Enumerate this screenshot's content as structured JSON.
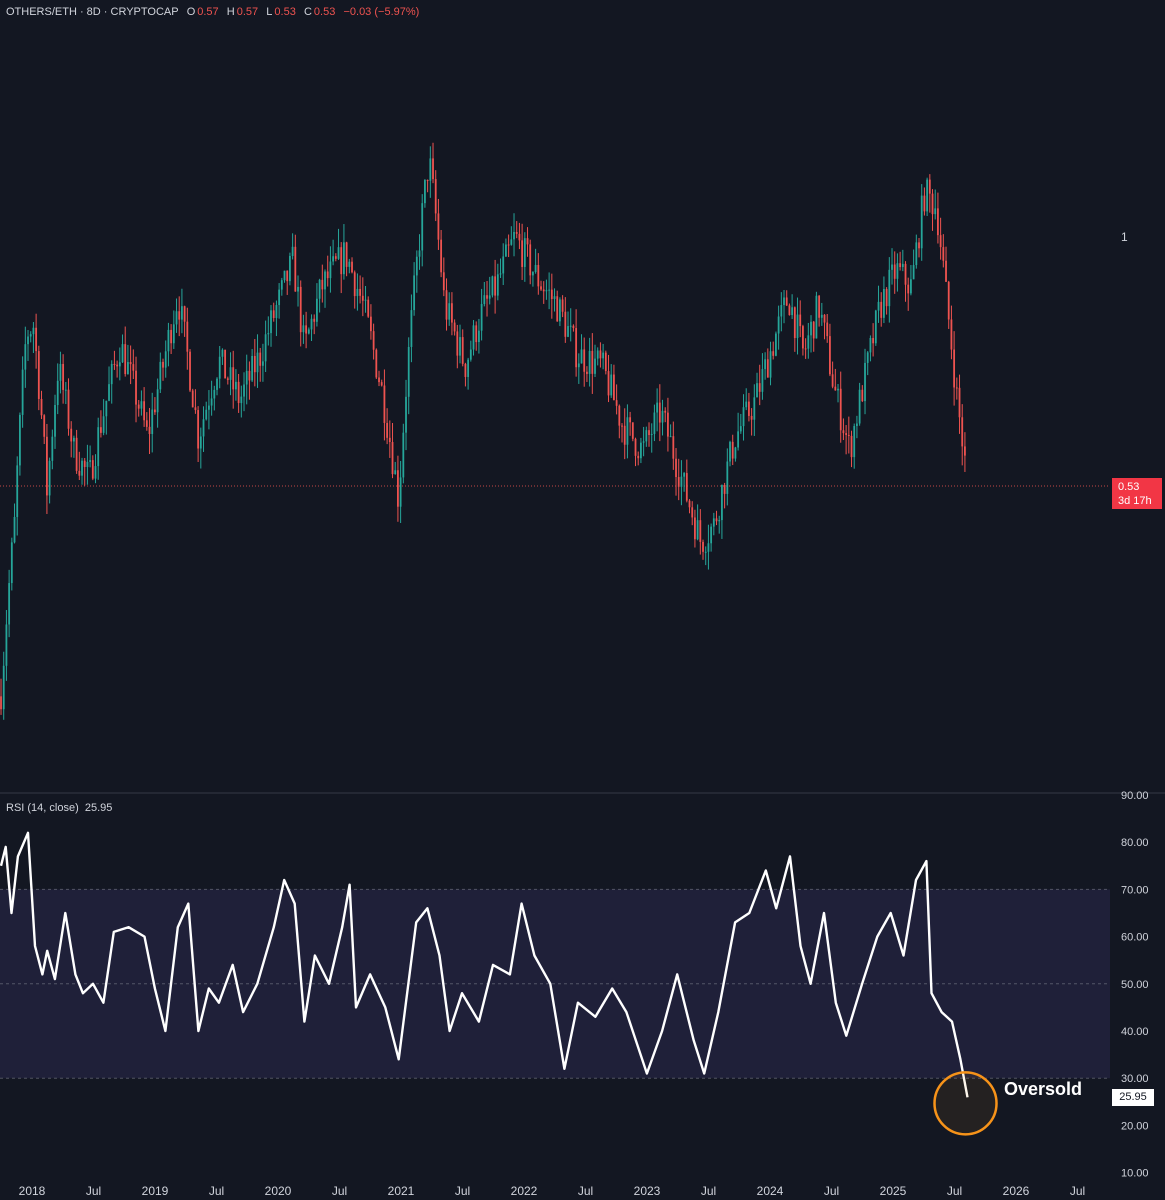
{
  "header": {
    "symbol": "OTHERS/ETH · 8D · CRYPTOCAP",
    "o_label": "O",
    "o_value": "0.57",
    "h_label": "H",
    "h_value": "0.57",
    "l_label": "L",
    "l_value": "0.53",
    "c_label": "C",
    "c_value": "0.53",
    "change": "−0.03 (−5.97%)"
  },
  "price_pane": {
    "axis_label": "1",
    "last_price": "0.53",
    "countdown": "3d 17h"
  },
  "rsi_pane": {
    "label": "RSI (14, close)",
    "value": "25.95",
    "axis_labels": [
      "90.00",
      "80.00",
      "70.00",
      "60.00",
      "50.00",
      "40.00",
      "30.00",
      "20.00",
      "10.00"
    ],
    "annotation": "Oversold"
  },
  "x_axis": [
    "2018",
    "Jul",
    "2019",
    "Jul",
    "2020",
    "Jul",
    "2021",
    "Jul",
    "2022",
    "Jul",
    "2023",
    "Jul",
    "2024",
    "Jul",
    "2025",
    "Jul",
    "2026",
    "Jul"
  ],
  "colors": {
    "background": "#131722",
    "up": "#26a69a",
    "down": "#ef5350",
    "rsi_line": "#ffffff",
    "rsi_band": "#1f2039",
    "annotation": "#f7931a"
  },
  "chart_data": [
    {
      "type": "candlestick",
      "title": "OTHERS/ETH · 8D · CRYPTOCAP",
      "scale": "log",
      "x_range": [
        "2017-10",
        "2026-08"
      ],
      "price_path": [
        [
          "2017-10-01",
          0.31
        ],
        [
          "2017-11-10",
          0.48
        ],
        [
          "2017-12-15",
          0.78
        ],
        [
          "2018-01-05",
          0.8
        ],
        [
          "2018-02-15",
          0.52
        ],
        [
          "2018-03-20",
          0.72
        ],
        [
          "2018-05-05",
          0.58
        ],
        [
          "2018-06-20",
          0.54
        ],
        [
          "2018-08-10",
          0.66
        ],
        [
          "2018-09-20",
          0.76
        ],
        [
          "2018-12-10",
          0.6
        ],
        [
          "2019-01-25",
          0.72
        ],
        [
          "2019-03-10",
          0.86
        ],
        [
          "2019-05-10",
          0.6
        ],
        [
          "2019-07-10",
          0.73
        ],
        [
          "2019-09-10",
          0.66
        ],
        [
          "2019-11-10",
          0.74
        ],
        [
          "2020-01-10",
          0.86
        ],
        [
          "2020-02-15",
          0.94
        ],
        [
          "2020-03-20",
          0.75
        ],
        [
          "2020-05-10",
          0.88
        ],
        [
          "2020-07-20",
          0.96
        ],
        [
          "2020-09-10",
          0.84
        ],
        [
          "2020-11-10",
          0.66
        ],
        [
          "2020-12-25",
          0.51
        ],
        [
          "2021-02-10",
          0.88
        ],
        [
          "2021-03-25",
          1.22
        ],
        [
          "2021-05-10",
          0.84
        ],
        [
          "2021-07-10",
          0.72
        ],
        [
          "2021-08-25",
          0.82
        ],
        [
          "2021-10-10",
          0.88
        ],
        [
          "2021-12-05",
          1.0
        ],
        [
          "2022-02-10",
          0.9
        ],
        [
          "2022-04-10",
          0.84
        ],
        [
          "2022-06-10",
          0.74
        ],
        [
          "2022-08-20",
          0.72
        ],
        [
          "2022-10-20",
          0.62
        ],
        [
          "2022-12-20",
          0.58
        ],
        [
          "2023-02-10",
          0.64
        ],
        [
          "2023-04-20",
          0.53
        ],
        [
          "2023-06-10",
          0.46
        ],
        [
          "2023-07-20",
          0.48
        ],
        [
          "2023-09-20",
          0.6
        ],
        [
          "2023-11-20",
          0.66
        ],
        [
          "2024-01-10",
          0.76
        ],
        [
          "2024-02-25",
          0.86
        ],
        [
          "2024-04-10",
          0.74
        ],
        [
          "2024-05-25",
          0.84
        ],
        [
          "2024-07-10",
          0.68
        ],
        [
          "2024-08-25",
          0.58
        ],
        [
          "2024-10-10",
          0.7
        ],
        [
          "2024-11-25",
          0.84
        ],
        [
          "2025-01-10",
          0.92
        ],
        [
          "2025-02-25",
          0.88
        ],
        [
          "2025-04-05",
          1.12
        ],
        [
          "2025-05-10",
          1.08
        ],
        [
          "2025-06-10",
          0.84
        ],
        [
          "2025-07-10",
          0.66
        ],
        [
          "2025-08-10",
          0.53
        ]
      ],
      "last_price": 0.53
    },
    {
      "type": "line",
      "title": "RSI (14, close)",
      "ylim": [
        10,
        90
      ],
      "band": [
        30,
        70
      ],
      "midline": 50,
      "series": [
        {
          "name": "RSI (14, close)",
          "points": [
            [
              "2017-10-01",
              75
            ],
            [
              "2017-10-15",
              79
            ],
            [
              "2017-11-01",
              65
            ],
            [
              "2017-11-20",
              77
            ],
            [
              "2017-12-20",
              82
            ],
            [
              "2018-01-10",
              58
            ],
            [
              "2018-02-01",
              52
            ],
            [
              "2018-02-15",
              57
            ],
            [
              "2018-03-10",
              51
            ],
            [
              "2018-04-10",
              65
            ],
            [
              "2018-05-10",
              52
            ],
            [
              "2018-06-01",
              48
            ],
            [
              "2018-07-01",
              50
            ],
            [
              "2018-08-01",
              46
            ],
            [
              "2018-09-01",
              61
            ],
            [
              "2018-10-15",
              62
            ],
            [
              "2018-12-01",
              60
            ],
            [
              "2019-01-01",
              49
            ],
            [
              "2019-02-01",
              40
            ],
            [
              "2019-03-10",
              62
            ],
            [
              "2019-04-10",
              67
            ],
            [
              "2019-05-10",
              40
            ],
            [
              "2019-06-10",
              49
            ],
            [
              "2019-07-10",
              46
            ],
            [
              "2019-08-20",
              54
            ],
            [
              "2019-09-20",
              44
            ],
            [
              "2019-11-01",
              50
            ],
            [
              "2019-12-20",
              62
            ],
            [
              "2020-01-20",
              72
            ],
            [
              "2020-02-20",
              67
            ],
            [
              "2020-03-20",
              42
            ],
            [
              "2020-04-20",
              56
            ],
            [
              "2020-06-01",
              50
            ],
            [
              "2020-07-10",
              62
            ],
            [
              "2020-08-01",
              71
            ],
            [
              "2020-08-20",
              45
            ],
            [
              "2020-10-01",
              52
            ],
            [
              "2020-11-15",
              45
            ],
            [
              "2020-12-25",
              34
            ],
            [
              "2021-02-15",
              63
            ],
            [
              "2021-03-20",
              66
            ],
            [
              "2021-04-25",
              56
            ],
            [
              "2021-05-25",
              40
            ],
            [
              "2021-07-01",
              48
            ],
            [
              "2021-08-20",
              42
            ],
            [
              "2021-10-01",
              54
            ],
            [
              "2021-11-20",
              52
            ],
            [
              "2021-12-25",
              67
            ],
            [
              "2022-02-01",
              56
            ],
            [
              "2022-03-20",
              50
            ],
            [
              "2022-05-01",
              32
            ],
            [
              "2022-06-10",
              46
            ],
            [
              "2022-08-01",
              43
            ],
            [
              "2022-09-20",
              49
            ],
            [
              "2022-11-01",
              44
            ],
            [
              "2023-01-01",
              31
            ],
            [
              "2023-02-15",
              40
            ],
            [
              "2023-04-01",
              52
            ],
            [
              "2023-05-20",
              38
            ],
            [
              "2023-06-20",
              31
            ],
            [
              "2023-08-01",
              44
            ],
            [
              "2023-09-20",
              63
            ],
            [
              "2023-11-01",
              65
            ],
            [
              "2023-12-20",
              74
            ],
            [
              "2024-01-20",
              66
            ],
            [
              "2024-03-01",
              77
            ],
            [
              "2024-04-01",
              58
            ],
            [
              "2024-05-01",
              50
            ],
            [
              "2024-06-10",
              65
            ],
            [
              "2024-07-15",
              46
            ],
            [
              "2024-08-15",
              39
            ],
            [
              "2024-10-01",
              50
            ],
            [
              "2024-11-15",
              60
            ],
            [
              "2024-12-25",
              65
            ],
            [
              "2025-02-01",
              56
            ],
            [
              "2025-03-10",
              72
            ],
            [
              "2025-04-10",
              76
            ],
            [
              "2025-04-25",
              48
            ],
            [
              "2025-05-25",
              44
            ],
            [
              "2025-06-25",
              42
            ],
            [
              "2025-07-20",
              34
            ],
            [
              "2025-08-10",
              25.95
            ]
          ]
        }
      ],
      "annotation": "Oversold"
    }
  ]
}
